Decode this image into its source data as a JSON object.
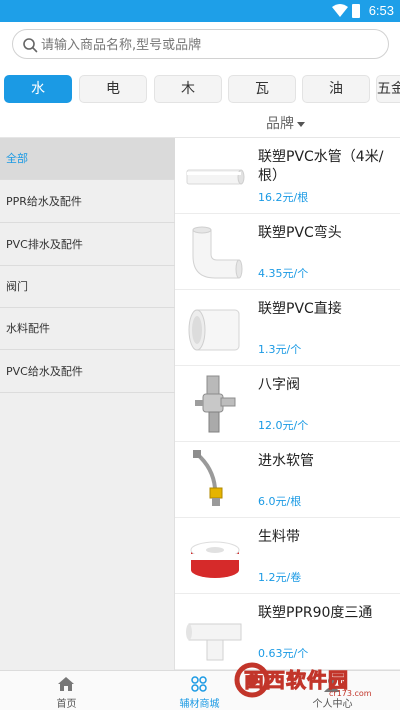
{
  "status_bar": {
    "time": "6:53"
  },
  "search": {
    "placeholder": "请输入商品名称,型号或品牌"
  },
  "tabs": [
    {
      "label": "水",
      "active": true
    },
    {
      "label": "电"
    },
    {
      "label": "木"
    },
    {
      "label": "瓦"
    },
    {
      "label": "油"
    },
    {
      "label": "五金"
    }
  ],
  "filter": {
    "label": "品牌"
  },
  "sidebar": {
    "items": [
      {
        "label": "全部",
        "active": true
      },
      {
        "label": "PPR给水及配件"
      },
      {
        "label": "PVC排水及配件"
      },
      {
        "label": "阀门"
      },
      {
        "label": "水料配件"
      },
      {
        "label": "PVC给水及配件"
      }
    ]
  },
  "products": [
    {
      "name": "联塑PVC水管（4米/根）",
      "price": "16.2元/根",
      "thumb": "pvc-pipe"
    },
    {
      "name": "联塑PVC弯头",
      "price": "4.35元/个",
      "thumb": "pvc-elbow"
    },
    {
      "name": "联塑PVC直接",
      "price": "1.3元/个",
      "thumb": "pvc-coupling"
    },
    {
      "name": "八字阀",
      "price": "12.0元/个",
      "thumb": "angle-valve"
    },
    {
      "name": "进水软管",
      "price": "6.0元/根",
      "thumb": "water-hose"
    },
    {
      "name": "生料带",
      "price": "1.2元/卷",
      "thumb": "ptfe-tape"
    },
    {
      "name": "联塑PPR90度三通",
      "price": "0.63元/个",
      "thumb": "ppr-tee"
    }
  ],
  "bottom_nav": [
    {
      "label": "首页",
      "icon": "home-icon"
    },
    {
      "label": "辅材商城",
      "icon": "grid-icon",
      "active": true
    },
    {
      "label": "个人中心",
      "icon": "user-icon"
    }
  ],
  "watermark": {
    "text": "西西软件园",
    "url_text": "cr173.com"
  },
  "colors": {
    "accent": "#1b9ae4",
    "status_bar": "#1e9fe8",
    "sidebar_bg": "#efefef"
  }
}
